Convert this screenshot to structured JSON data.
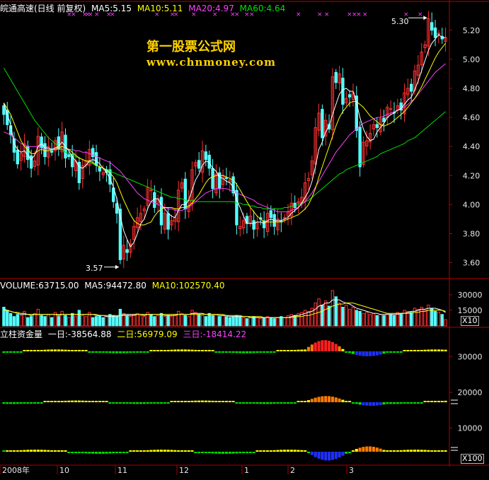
{
  "header": {
    "title": "皖通高速(日线 前复权)",
    "ma5": "MA5:5.15",
    "ma10": "MA10:5.11",
    "ma20": "MA20:4.97",
    "ma60": "MA60:4.64"
  },
  "watermark": {
    "name": "第一股票公式网",
    "url": "www.chnmoney.com"
  },
  "volume_header": {
    "volume": "VOLUME:63715.00",
    "ma5": "MA5:94472.80",
    "ma10": "MA10:102570.40"
  },
  "fund_header": {
    "title": "立柱资金量",
    "d1": "一日:-38564.88",
    "d2": "二日:56979.09",
    "d3": "三日:-18414.22"
  },
  "annotations": {
    "high": "5.30",
    "low": "3.57"
  },
  "scale_labels": {
    "vol": "X10",
    "fund": "X100"
  },
  "colors": {
    "up": "#ff3030",
    "down": "#54ffff",
    "ma5": "#ffffff",
    "ma10": "#ffff00",
    "ma20": "#ff40ff",
    "ma60": "#00e000"
  },
  "chart_data": [
    {
      "type": "candlestick",
      "name": "price",
      "y_ticks": [
        "5.20",
        "5.00",
        "4.80",
        "4.60",
        "4.40",
        "4.20",
        "4.00",
        "3.80",
        "3.60"
      ],
      "ylim": [
        3.52,
        5.34
      ],
      "x_labels": [
        "2008年",
        "10",
        "11",
        "12",
        "1",
        "2",
        "3"
      ],
      "close": [
        4.62,
        4.55,
        4.48,
        4.36,
        4.28,
        4.35,
        4.42,
        4.31,
        4.25,
        4.3,
        4.47,
        4.39,
        4.33,
        4.4,
        4.36,
        4.44,
        4.38,
        4.5,
        4.32,
        4.33,
        4.26,
        4.3,
        4.15,
        4.27,
        4.3,
        4.38,
        4.33,
        4.27,
        4.23,
        4.22,
        4.22,
        4.14,
        4.02,
        3.94,
        3.62,
        3.72,
        3.67,
        3.73,
        3.85,
        3.91,
        3.94,
        3.97,
        4.12,
        4.1,
        3.98,
        4.04,
        3.86,
        3.94,
        3.83,
        3.89,
        3.91,
        4.1,
        4.15,
        3.97,
        4.03,
        4.24,
        4.29,
        4.25,
        4.37,
        4.31,
        4.25,
        4.11,
        4.21,
        4.11,
        4.2,
        4.18,
        4.17,
        4.08,
        3.86,
        3.85,
        3.89,
        3.87,
        3.92,
        3.83,
        3.88,
        3.9,
        3.84,
        3.94,
        3.91,
        3.85,
        3.9,
        3.88,
        3.91,
        3.95,
        4.01,
        3.98,
        4.02,
        4.05,
        4.15,
        4.18,
        4.3,
        4.53,
        4.63,
        4.46,
        4.58,
        4.52,
        4.88,
        4.84,
        4.9,
        4.69,
        4.73,
        4.74,
        4.77,
        4.51,
        4.26,
        4.43,
        4.44,
        4.49,
        4.55,
        4.53,
        4.59,
        4.57,
        4.67,
        4.66,
        4.63,
        4.68,
        4.65,
        4.77,
        4.8,
        4.78,
        4.92,
        4.96,
        5.05,
        5.1,
        5.28,
        5.2,
        5.15,
        5.18,
        5.14,
        5.15
      ],
      "ma5": [
        4.7,
        4.62,
        4.55,
        4.42,
        4.38,
        4.36,
        4.37,
        4.34,
        4.31,
        4.34,
        4.4,
        4.42,
        4.39,
        4.39,
        4.38,
        4.39,
        4.4,
        4.43,
        4.4,
        4.37,
        4.33,
        4.3,
        4.26,
        4.25,
        4.27,
        4.3,
        4.31,
        4.3,
        4.28,
        4.25,
        4.22,
        4.18,
        4.12,
        4.04,
        3.92,
        3.82,
        3.76,
        3.71,
        3.74,
        3.8,
        3.87,
        3.9,
        3.97,
        4.02,
        4.04,
        4.04,
        4.0,
        3.97,
        3.94,
        3.92,
        3.91,
        3.96,
        4.0,
        4.0,
        4.03,
        4.1,
        4.17,
        4.21,
        4.27,
        4.3,
        4.29,
        4.25,
        4.23,
        4.19,
        4.18,
        4.16,
        4.15,
        4.12,
        4.03,
        3.98,
        3.92,
        3.87,
        3.87,
        3.87,
        3.88,
        3.88,
        3.87,
        3.89,
        3.9,
        3.89,
        3.89,
        3.89,
        3.9,
        3.91,
        3.94,
        3.96,
        3.98,
        4.01,
        4.05,
        4.09,
        4.16,
        4.26,
        4.38,
        4.43,
        4.5,
        4.54,
        4.62,
        4.69,
        4.76,
        4.79,
        4.8,
        4.78,
        4.78,
        4.7,
        4.6,
        4.52,
        4.47,
        4.44,
        4.45,
        4.5,
        4.53,
        4.56,
        4.6,
        4.62,
        4.63,
        4.65,
        4.66,
        4.69,
        4.72,
        4.74,
        4.79,
        4.85,
        4.92,
        4.99,
        5.06,
        5.11,
        5.14,
        5.17,
        5.15,
        5.15
      ],
      "ma10": [
        4.7,
        4.66,
        4.62,
        4.56,
        4.5,
        4.44,
        4.4,
        4.38,
        4.35,
        4.35,
        4.37,
        4.38,
        4.37,
        4.37,
        4.38,
        4.38,
        4.39,
        4.4,
        4.39,
        4.38,
        4.36,
        4.34,
        4.32,
        4.31,
        4.3,
        4.3,
        4.29,
        4.27,
        4.26,
        4.25,
        4.24,
        4.22,
        4.19,
        4.15,
        4.09,
        4.03,
        3.98,
        3.93,
        3.89,
        3.87,
        3.86,
        3.86,
        3.87,
        3.88,
        3.92,
        3.95,
        3.97,
        3.98,
        3.98,
        3.98,
        3.97,
        3.97,
        3.98,
        3.98,
        3.99,
        4.01,
        4.04,
        4.07,
        4.11,
        4.15,
        4.18,
        4.19,
        4.2,
        4.2,
        4.2,
        4.19,
        4.18,
        4.17,
        4.14,
        4.1,
        4.06,
        4.02,
        3.98,
        3.95,
        3.92,
        3.9,
        3.88,
        3.88,
        3.88,
        3.88,
        3.88,
        3.88,
        3.89,
        3.9,
        3.91,
        3.92,
        3.93,
        3.95,
        3.97,
        4.0,
        4.05,
        4.11,
        4.19,
        4.26,
        4.33,
        4.4,
        4.47,
        4.54,
        4.6,
        4.64,
        4.67,
        4.7,
        4.71,
        4.71,
        4.69,
        4.67,
        4.64,
        4.61,
        4.59,
        4.57,
        4.55,
        4.54,
        4.55,
        4.56,
        4.58,
        4.6,
        4.62,
        4.64,
        4.67,
        4.7,
        4.73,
        4.77,
        4.81,
        4.86,
        4.91,
        4.96,
        5.01,
        5.05,
        5.08,
        5.11
      ],
      "ma20": [
        4.5,
        4.49,
        4.48,
        4.46,
        4.44,
        4.42,
        4.41,
        4.4,
        4.4,
        4.4,
        4.4,
        4.39,
        4.38,
        4.38,
        4.38,
        4.38,
        4.38,
        4.38,
        4.38,
        4.38,
        4.38,
        4.37,
        4.37,
        4.36,
        4.36,
        4.35,
        4.34,
        4.33,
        4.32,
        4.31,
        4.3,
        4.29,
        4.27,
        4.25,
        4.23,
        4.2,
        4.17,
        4.14,
        4.11,
        4.08,
        4.06,
        4.04,
        4.03,
        4.02,
        4.01,
        4.0,
        3.99,
        3.98,
        3.97,
        3.97,
        3.96,
        3.96,
        3.96,
        3.97,
        3.98,
        4.0,
        4.02,
        4.04,
        4.06,
        4.08,
        4.09,
        4.1,
        4.11,
        4.11,
        4.11,
        4.11,
        4.1,
        4.09,
        4.08,
        4.07,
        4.06,
        4.05,
        4.04,
        4.03,
        4.01,
        4.0,
        3.99,
        3.98,
        3.97,
        3.96,
        3.95,
        3.95,
        3.95,
        3.95,
        3.96,
        3.97,
        3.98,
        4.0,
        4.02,
        4.05,
        4.08,
        4.12,
        4.16,
        4.2,
        4.24,
        4.28,
        4.32,
        4.36,
        4.39,
        4.42,
        4.45,
        4.48,
        4.5,
        4.52,
        4.54,
        4.56,
        4.57,
        4.58,
        4.59,
        4.6,
        4.6,
        4.61,
        4.62,
        4.63,
        4.64,
        4.65,
        4.66,
        4.67,
        4.69,
        4.71,
        4.73,
        4.76,
        4.79,
        4.82,
        4.85,
        4.88,
        4.91,
        4.93,
        4.95,
        4.97
      ],
      "ma60": [
        4.94,
        4.9,
        4.86,
        4.82,
        4.78,
        4.74,
        4.7,
        4.66,
        4.62,
        4.58,
        4.55,
        4.52,
        4.49,
        4.46,
        4.44,
        4.42,
        4.4,
        4.38,
        4.36,
        4.35,
        4.34,
        4.33,
        4.32,
        4.31,
        4.3,
        4.29,
        4.28,
        4.27,
        4.26,
        4.25,
        4.24,
        4.23,
        4.22,
        4.21,
        4.2,
        4.19,
        4.18,
        4.17,
        4.16,
        4.15,
        4.14,
        4.13,
        4.12,
        4.11,
        4.1,
        4.09,
        4.08,
        4.07,
        4.06,
        4.05,
        4.05,
        4.04,
        4.04,
        4.03,
        4.03,
        4.03,
        4.02,
        4.02,
        4.02,
        4.02,
        4.02,
        4.02,
        4.02,
        4.02,
        4.02,
        4.02,
        4.02,
        4.02,
        4.01,
        4.01,
        4.0,
        4.0,
        3.99,
        3.99,
        3.98,
        3.98,
        3.97,
        3.97,
        3.97,
        3.97,
        3.97,
        3.97,
        3.98,
        3.98,
        3.99,
        3.99,
        4.0,
        4.01,
        4.02,
        4.03,
        4.05,
        4.07,
        4.09,
        4.11,
        4.13,
        4.15,
        4.17,
        4.19,
        4.21,
        4.22,
        4.24,
        4.25,
        4.26,
        4.27,
        4.28,
        4.29,
        4.3,
        4.31,
        4.32,
        4.33,
        4.35,
        4.36,
        4.37,
        4.38,
        4.39,
        4.4,
        4.41,
        4.42,
        4.44,
        4.45,
        4.46,
        4.48,
        4.5,
        4.52,
        4.54,
        4.56,
        4.58,
        4.6,
        4.62,
        4.64
      ]
    },
    {
      "type": "bar",
      "name": "volume",
      "y_ticks": [
        "30000",
        "15000"
      ],
      "ylim": [
        0,
        36000
      ],
      "values": [
        18000,
        15000,
        12000,
        9000,
        11000,
        10000,
        14000,
        8000,
        9000,
        12000,
        16000,
        10000,
        9000,
        11000,
        8000,
        13000,
        9000,
        14000,
        10000,
        8000,
        12000,
        9000,
        15000,
        10000,
        9000,
        13000,
        8000,
        9000,
        10000,
        8000,
        9000,
        11000,
        10000,
        9000,
        16000,
        12000,
        10000,
        9000,
        11000,
        12000,
        10000,
        9000,
        13000,
        11000,
        9000,
        10000,
        12000,
        9000,
        10000,
        9000,
        11000,
        14000,
        12000,
        10000,
        9000,
        15000,
        13000,
        11000,
        10000,
        9000,
        12000,
        10000,
        11000,
        9000,
        10000,
        9000,
        8000,
        9000,
        10000,
        9000,
        8000,
        7000,
        8000,
        9000,
        8000,
        7000,
        8000,
        9000,
        8000,
        7000,
        8000,
        9000,
        8000,
        10000,
        11000,
        10000,
        12000,
        13000,
        15000,
        14000,
        17000,
        22000,
        26000,
        20000,
        24000,
        19000,
        34000,
        28000,
        22000,
        18000,
        20000,
        16000,
        18000,
        15000,
        14000,
        12000,
        13000,
        11000,
        12000,
        10000,
        11000,
        10000,
        12000,
        11000,
        10000,
        13000,
        12000,
        15000,
        14000,
        13000,
        17000,
        16000,
        18000,
        15000,
        20000,
        17000,
        14000,
        13000,
        11000,
        6000
      ],
      "vol_ma5": [
        16000,
        15000,
        14000,
        13000,
        12000,
        11000,
        11000,
        11000,
        10000,
        11000,
        11000,
        11000,
        11000,
        11000,
        11000,
        11000,
        10000,
        11000,
        11000,
        11000,
        11000,
        11000,
        11000,
        11000,
        11000,
        11000,
        11000,
        10000,
        10000,
        10000,
        9000,
        9000,
        9000,
        9000,
        10000,
        11000,
        11000,
        11000,
        11000,
        11000,
        11000,
        10000,
        11000,
        11000,
        11000,
        11000,
        11000,
        10000,
        10000,
        10000,
        10000,
        11000,
        11000,
        11000,
        11000,
        12000,
        12000,
        12000,
        12000,
        11000,
        11000,
        11000,
        11000,
        10000,
        10000,
        10000,
        9000,
        9000,
        9000,
        9000,
        9000,
        9000,
        8000,
        8000,
        8000,
        8000,
        8000,
        8000,
        8000,
        8000,
        8000,
        8000,
        8000,
        8000,
        9000,
        10000,
        10000,
        11000,
        12000,
        13000,
        14000,
        16000,
        19000,
        20000,
        22000,
        22000,
        25000,
        25000,
        25000,
        23000,
        22000,
        21000,
        19000,
        17000,
        16000,
        15000,
        14000,
        13000,
        12000,
        12000,
        11000,
        11000,
        11000,
        11000,
        11000,
        11000,
        12000,
        12000,
        13000,
        14000,
        14000,
        15000,
        16000,
        16000,
        17000,
        17000,
        17000,
        16000,
        15000,
        13000
      ],
      "vol_ma10": [
        15000,
        15000,
        14000,
        13000,
        13000,
        12000,
        12000,
        11000,
        11000,
        11000,
        11000,
        11000,
        11000,
        11000,
        11000,
        11000,
        11000,
        11000,
        11000,
        11000,
        11000,
        11000,
        11000,
        11000,
        11000,
        11000,
        11000,
        11000,
        10000,
        10000,
        10000,
        10000,
        10000,
        10000,
        10000,
        10000,
        10000,
        10000,
        10000,
        11000,
        11000,
        11000,
        11000,
        11000,
        11000,
        11000,
        11000,
        11000,
        11000,
        11000,
        11000,
        11000,
        11000,
        11000,
        11000,
        11000,
        11000,
        11000,
        11000,
        11000,
        11000,
        11000,
        11000,
        11000,
        11000,
        10000,
        10000,
        10000,
        10000,
        10000,
        9000,
        9000,
        9000,
        9000,
        9000,
        9000,
        8000,
        8000,
        8000,
        8000,
        8000,
        8000,
        8000,
        8000,
        8000,
        9000,
        9000,
        9000,
        10000,
        10000,
        11000,
        12000,
        13000,
        14000,
        16000,
        17000,
        19000,
        20000,
        21000,
        21000,
        22000,
        22000,
        22000,
        21000,
        20000,
        19000,
        18000,
        17000,
        16000,
        15000,
        14000,
        13000,
        12000,
        12000,
        12000,
        12000,
        12000,
        12000,
        12000,
        12000,
        13000,
        13000,
        14000,
        14000,
        15000,
        15000,
        15000,
        15000,
        15000,
        14000
      ]
    },
    {
      "type": "bar",
      "name": "fund-flow",
      "y_ticks": [
        "30000",
        "20000",
        "10000"
      ],
      "ylim": [
        0,
        36000
      ]
    }
  ]
}
